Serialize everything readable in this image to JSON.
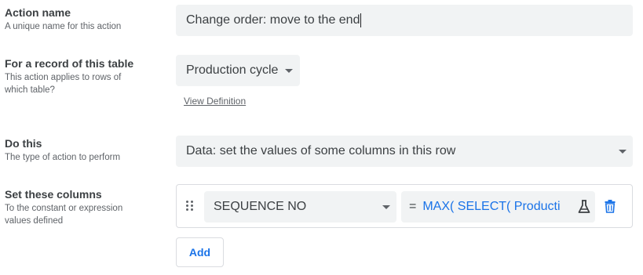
{
  "action_name": {
    "title": "Action name",
    "description": "A unique name for this action",
    "value": "Change order: move to the end"
  },
  "table": {
    "title": "For a record of this table",
    "description": "This action applies to rows of which table?",
    "selected": "Production cycle",
    "link": "View Definition"
  },
  "do_this": {
    "title": "Do this",
    "description": "The type of action to perform",
    "selected": "Data: set the values of some columns in this row"
  },
  "set_columns": {
    "title": "Set these columns",
    "description": "To the constant or expression values defined",
    "rows": [
      {
        "column": "SEQUENCE NO",
        "operator": "=",
        "expression": "MAX(  SELECT(   Producti"
      }
    ],
    "add_label": "Add"
  },
  "colors": {
    "accent": "#1a73e8",
    "field_bg": "#f1f3f4",
    "border": "#dadce0"
  },
  "icons": [
    "caret-down-icon",
    "drag-handle-icon",
    "flask-icon",
    "trash-icon"
  ]
}
